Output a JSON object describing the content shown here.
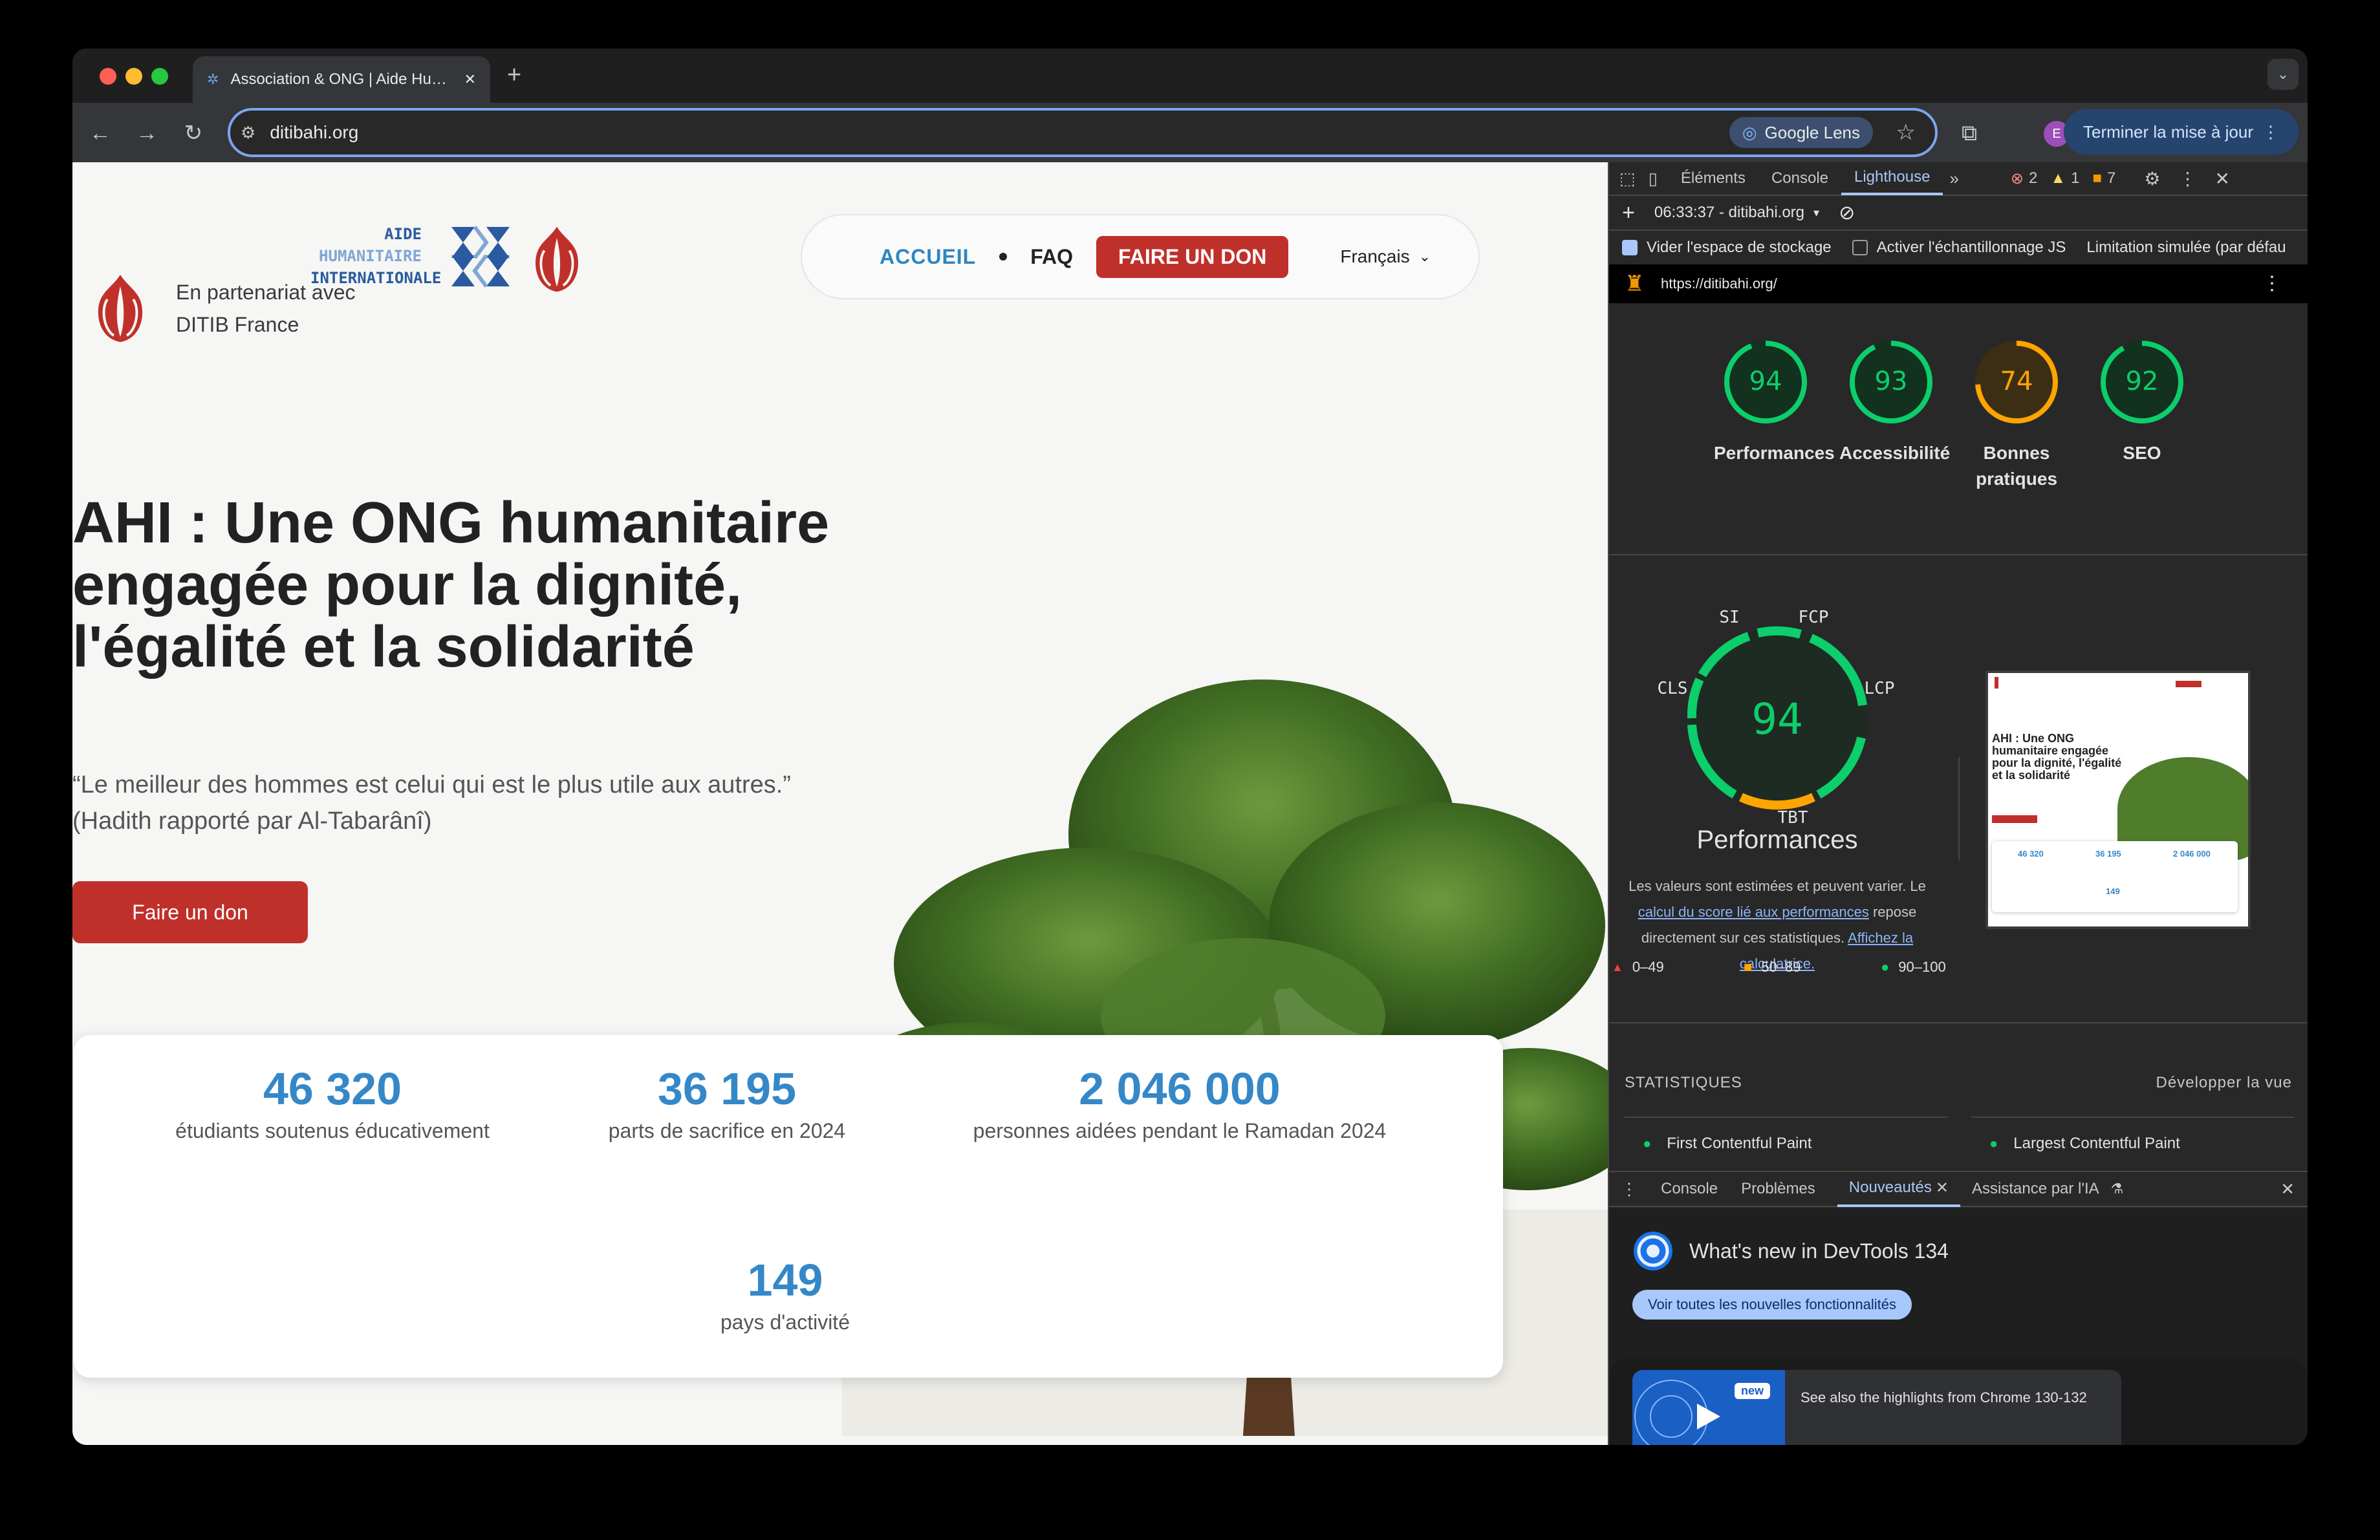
{
  "browser": {
    "tab_title": "Association & ONG | Aide Hu…",
    "url": "ditibahi.org",
    "lens_label": "Google Lens",
    "update_label": "Terminer la mise à jour",
    "profile_initial": "E"
  },
  "site": {
    "partner_line1": "En partenariat avec",
    "partner_line2": "DITIB France",
    "brand_line1": "AIDE",
    "brand_line2": "HUMANITAIRE",
    "brand_line3": "INTERNATIONALE",
    "nav": {
      "home": "ACCUEIL",
      "faq": "FAQ",
      "donate": "FAIRE UN DON",
      "language": "Français"
    },
    "hero_title": "AHI : Une ONG humanitaire engagée pour la dignité, l'égalité et la solidarité",
    "hero_quote": "“Le meilleur des hommes est celui qui est le plus utile aux autres.”",
    "hero_source": "(Hadith rapporté par Al-Tabarânî)",
    "hero_button": "Faire un don",
    "stats": [
      {
        "number": "46 320",
        "label": "étudiants soutenus éducativement"
      },
      {
        "number": "36 195",
        "label": "parts de sacrifice en 2024"
      },
      {
        "number": "2 046 000",
        "label": "personnes aidées pendant le Ramadan 2024"
      },
      {
        "number": "149",
        "label": "pays d'activité"
      }
    ]
  },
  "devtools": {
    "tabs": [
      "Éléments",
      "Console",
      "Lighthouse"
    ],
    "active_tab": "Lighthouse",
    "errors": "2",
    "warnings": "1",
    "issues": "7",
    "report_select": "06:33:37 - ditibahi.org",
    "opt_storage": "Vider l'espace de stockage",
    "opt_sampling": "Activer l'échantillonnage JS",
    "opt_throttle": "Limitation simulée (par défau",
    "report_url": "https://ditibahi.org/",
    "scores": [
      {
        "value": 94,
        "label": "Performances",
        "color": "#0cce6b"
      },
      {
        "value": 93,
        "label": "Accessibilité",
        "color": "#0cce6b"
      },
      {
        "value": 74,
        "label": "Bonnes pratiques",
        "color": "#ffa400"
      },
      {
        "value": 92,
        "label": "SEO",
        "color": "#0cce6b"
      }
    ],
    "perf_score": "94",
    "perf_label": "Performances",
    "perf_metrics": {
      "si": "SI",
      "fcp": "FCP",
      "lcp": "LCP",
      "tbt": "TBT",
      "cls": "CLS"
    },
    "note_part1": "Les valeurs sont estimées et peuvent varier. Le",
    "note_link1": "calcul du score lié aux performances",
    "note_part2": "repose directement sur ces statistiques.",
    "note_link2": "Affichez la calculatrice.",
    "legend": [
      "0–49",
      "50–89",
      "90–100"
    ],
    "stats_heading": "STATISTIQUES",
    "expand_view": "Développer la vue",
    "metric1": "First Contentful Paint",
    "metric2": "Largest Contentful Paint",
    "drawer_tabs": [
      "Console",
      "Problèmes",
      "Nouveautés",
      "Assistance par l'IA"
    ],
    "whats_new_title": "What's new in DevTools 134",
    "whats_new_button": "Voir toutes les nouvelles fonctionnalités",
    "new_badge": "new",
    "highlights": "See also the highlights from Chrome 130-132"
  }
}
